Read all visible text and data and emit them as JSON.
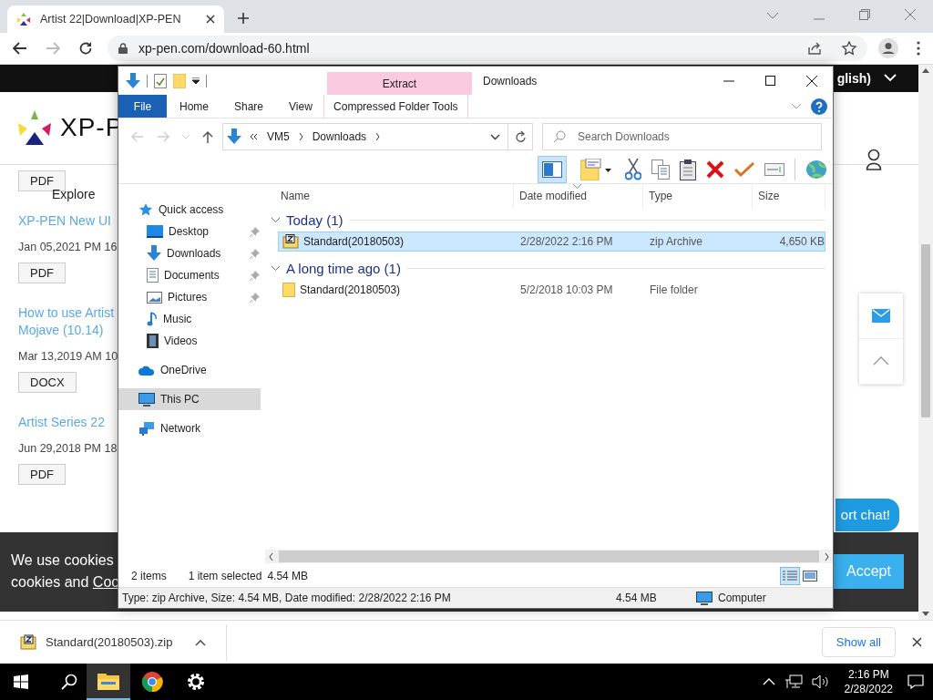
{
  "browser": {
    "tab": {
      "title": "Artist 22|Download|XP-PEN"
    },
    "address": "xp-pen.com/download-60.html"
  },
  "page": {
    "nav_text": "glish)",
    "logo": "XP-P",
    "explore": "Explore",
    "items": [
      {
        "kind": "button",
        "text": "PDF"
      },
      {
        "kind": "link",
        "lines": [
          "XP-PEN New UI"
        ]
      },
      {
        "kind": "date",
        "text": "Jan 05,2021 PM 16"
      },
      {
        "kind": "button",
        "text": "PDF"
      },
      {
        "kind": "link",
        "lines": [
          "How to use Artist",
          "Mojave (10.14)"
        ]
      },
      {
        "kind": "date",
        "text": "Mar 13,2019 AM 10"
      },
      {
        "kind": "button",
        "text": "DOCX"
      },
      {
        "kind": "link",
        "lines": [
          "Artist Series 22"
        ]
      },
      {
        "kind": "date",
        "text": "Jun 29,2018 PM 18"
      },
      {
        "kind": "button",
        "text": "PDF"
      }
    ],
    "chat": "ort chat!",
    "cookie": {
      "line1": "We use cookies",
      "line2": "cookies and",
      "link": "Coo",
      "accept": "Accept"
    }
  },
  "explorer": {
    "context_tab": "Extract",
    "title": "Downloads",
    "ribbon_tabs": [
      {
        "label": "File",
        "kind": "file"
      },
      {
        "label": "Home",
        "kind": "tab"
      },
      {
        "label": "Share",
        "kind": "tab"
      },
      {
        "label": "View",
        "kind": "tab"
      },
      {
        "label": "Compressed Folder Tools",
        "kind": "context"
      }
    ],
    "path": [
      "VM5",
      "Downloads"
    ],
    "search_placeholder": "Search Downloads",
    "preview_pane_on": true,
    "nav": [
      {
        "label": "Quick access",
        "kind": "star",
        "selected": false,
        "pinned": false,
        "children": [
          {
            "label": "Desktop",
            "kind": "desktop",
            "selected": false,
            "pinned": true
          },
          {
            "label": "Downloads",
            "kind": "download",
            "selected": false,
            "pinned": true
          },
          {
            "label": "Documents",
            "kind": "document",
            "selected": false,
            "pinned": true
          },
          {
            "label": "Pictures",
            "kind": "picture",
            "selected": false,
            "pinned": true
          },
          {
            "label": "Music",
            "kind": "music",
            "selected": false,
            "pinned": false
          },
          {
            "label": "Videos",
            "kind": "video",
            "selected": false,
            "pinned": false
          }
        ]
      },
      {
        "label": "OneDrive",
        "kind": "cloud",
        "selected": false,
        "pinned": false
      },
      {
        "label": "This PC",
        "kind": "pc",
        "selected": true,
        "pinned": false
      },
      {
        "label": "Network",
        "kind": "network",
        "selected": false,
        "pinned": false
      }
    ],
    "columns": [
      "Name",
      "Date modified",
      "Type",
      "Size"
    ],
    "groups": [
      {
        "label": "Today (1)",
        "expanded": true,
        "files": [
          {
            "name": "Standard(20180503)",
            "date": "2/28/2022 2:16 PM",
            "type": "zip Archive",
            "size": "4,650 KB",
            "kind": "zip",
            "selected": true
          }
        ]
      },
      {
        "label": "A long time ago (1)",
        "expanded": true,
        "files": [
          {
            "name": "Standard(20180503)",
            "date": "5/2/2018 10:03 PM",
            "type": "File folder",
            "kind": "folder",
            "selected": false
          }
        ]
      }
    ],
    "status": {
      "count": "2 items",
      "selection": "1 item selected",
      "selection_size": "4.54 MB"
    },
    "views": [
      {
        "kind": "details",
        "selected": true
      },
      {
        "kind": "large",
        "selected": false
      }
    ],
    "details": {
      "text": "Type: zip Archive, Size: 4.54 MB, Date modified: 2/28/2022 2:16 PM",
      "size": "4.54 MB",
      "location": "Computer"
    }
  },
  "download": {
    "file": "Standard(20180503).zip",
    "show_all": "Show all"
  },
  "taskbar": {
    "apps": [
      {
        "kind": "explorer",
        "selected": true
      },
      {
        "kind": "chrome",
        "selected": false
      },
      {
        "kind": "settings",
        "selected": false
      }
    ],
    "time": "2:16 PM",
    "date": "2/28/2022"
  }
}
